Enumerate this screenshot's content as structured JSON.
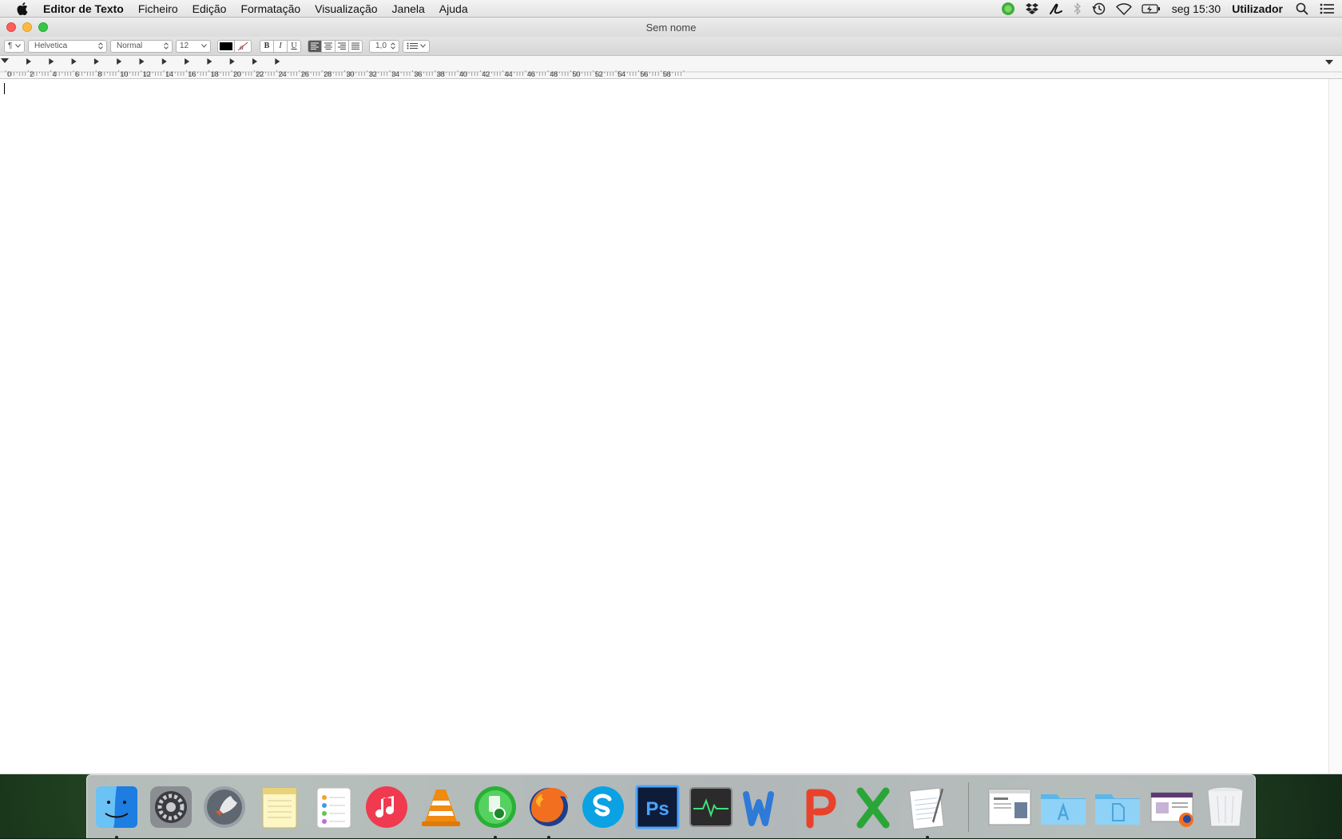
{
  "menubar": {
    "app_name": "Editor de Texto",
    "items": [
      "Ficheiro",
      "Edição",
      "Formatação",
      "Visualização",
      "Janela",
      "Ajuda"
    ],
    "clock": "seg 15:30",
    "user": "Utilizador"
  },
  "window": {
    "title": "Sem nome"
  },
  "toolbar": {
    "paragraph_style_symbol": "¶",
    "font_family": "Helvetica",
    "font_style": "Normal",
    "font_size": "12",
    "bold_label": "B",
    "italic_label": "I",
    "underline_label": "U",
    "line_spacing": "1,0",
    "text_color": "#000000"
  },
  "ruler": {
    "labels": [
      "0",
      "2",
      "4",
      "6",
      "8",
      "10",
      "12",
      "14",
      "16",
      "18",
      "20",
      "22",
      "24",
      "26",
      "28",
      "30",
      "32",
      "34",
      "36",
      "38",
      "40",
      "42",
      "44",
      "46",
      "48",
      "50",
      "52",
      "54",
      "56",
      "58"
    ]
  },
  "dock": {
    "apps": [
      {
        "name": "finder",
        "running": true
      },
      {
        "name": "system-preferences",
        "running": false
      },
      {
        "name": "launchpad",
        "running": false
      },
      {
        "name": "notes",
        "running": false
      },
      {
        "name": "reminders",
        "running": false
      },
      {
        "name": "itunes",
        "running": false
      },
      {
        "name": "vlc",
        "running": false
      },
      {
        "name": "network-app",
        "running": true
      },
      {
        "name": "firefox",
        "running": true
      },
      {
        "name": "skype",
        "running": false
      },
      {
        "name": "photoshop",
        "running": false
      },
      {
        "name": "activity-monitor",
        "running": false
      },
      {
        "name": "word",
        "running": false
      },
      {
        "name": "powerpoint",
        "running": false
      },
      {
        "name": "excel",
        "running": false
      },
      {
        "name": "textedit",
        "running": true
      }
    ],
    "photoshop_label": "Ps"
  }
}
